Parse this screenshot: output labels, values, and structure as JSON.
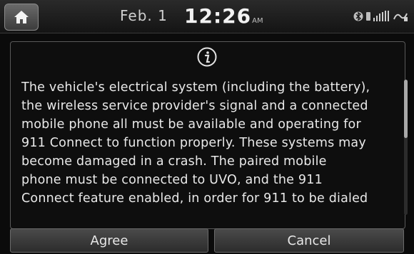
{
  "status_bar": {
    "date": "Feb. 1",
    "time": "12:26",
    "ampm": "AM",
    "icons": [
      "home-icon",
      "bluetooth-icon",
      "signal-strength-icon",
      "connectivity-icon"
    ]
  },
  "dialog": {
    "icon": "info-icon",
    "message": "The vehicle's electrical system (including the battery),\nthe wireless service provider's signal and a connected\nmobile phone all must be available and operating for\n911 Connect to function properly. These systems may\nbecome damaged in a crash. The paired mobile\nphone must be connected to UVO, and the 911\nConnect feature enabled, in order for 911 to be dialed",
    "scroll_fraction_visible": 0.43
  },
  "buttons": {
    "agree_label": "Agree",
    "cancel_label": "Cancel"
  }
}
